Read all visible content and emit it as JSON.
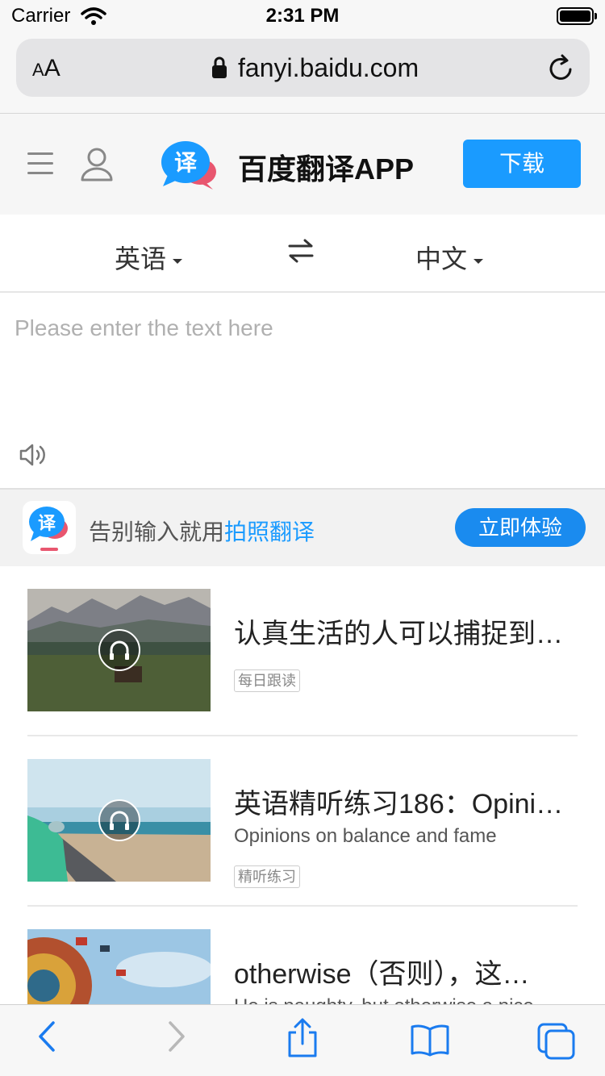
{
  "status_bar": {
    "carrier": "Carrier",
    "time": "2:31 PM"
  },
  "browser": {
    "text_size_small": "A",
    "text_size_large": "A",
    "url": "fanyi.baidu.com"
  },
  "header": {
    "app_title": "百度翻译APP",
    "logo_glyph": "译",
    "download_label": "下载"
  },
  "language": {
    "source": "英语",
    "target": "中文"
  },
  "input": {
    "placeholder": "Please enter the text here",
    "value": ""
  },
  "promo": {
    "text_prefix": "告别输入就用",
    "text_highlight": "拍照翻译",
    "button_label": "立即体验",
    "logo_glyph": "译"
  },
  "feed": {
    "items": [
      {
        "title": "认真生活的人可以捕捉到…",
        "subtitle": "",
        "tag": "每日跟读"
      },
      {
        "title": "英语精听练习186：Opini…",
        "subtitle": "Opinions on balance and fame",
        "tag": "精听练习"
      },
      {
        "title": "otherwise（否则），这…",
        "subtitle": "He is naughty, but otherwise a nice …",
        "tag": ""
      }
    ]
  },
  "colors": {
    "accent": "#1a9bff",
    "promo_button": "#1a8bef",
    "logo_pink": "#e8566f"
  }
}
